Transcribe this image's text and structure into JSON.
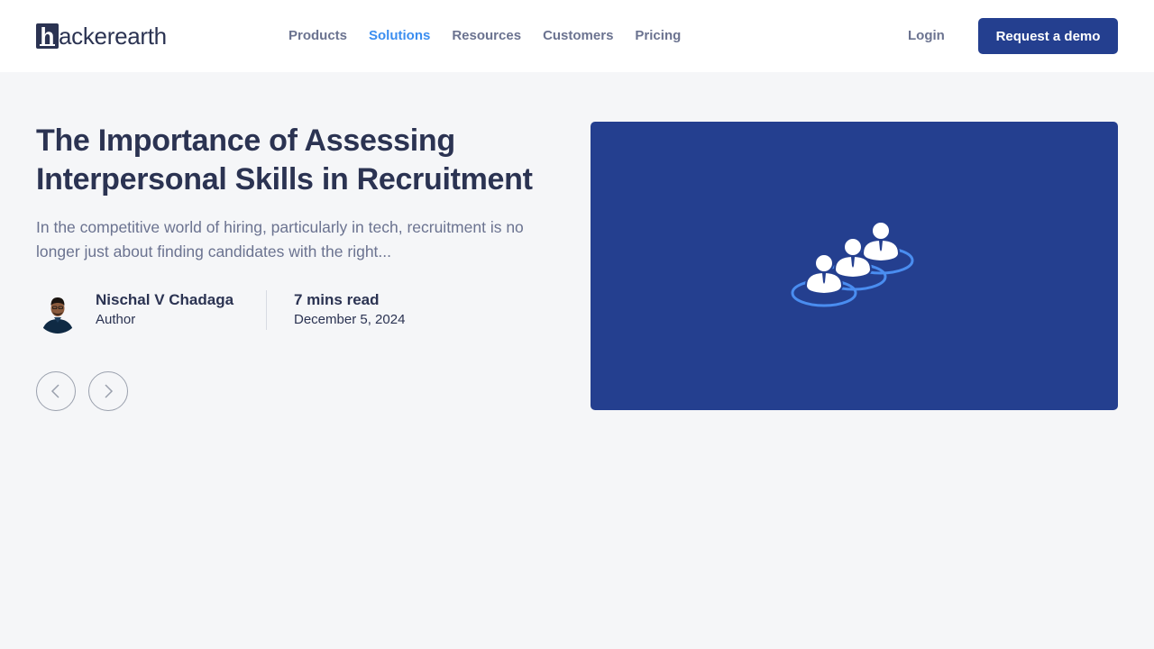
{
  "header": {
    "logo": {
      "mark": "h",
      "text": "ackerearth",
      "full": "hackerearth"
    },
    "nav": [
      {
        "label": "Products",
        "active": false
      },
      {
        "label": "Solutions",
        "active": true
      },
      {
        "label": "Resources",
        "active": false
      },
      {
        "label": "Customers",
        "active": false
      },
      {
        "label": "Pricing",
        "active": false
      }
    ],
    "login_label": "Login",
    "demo_label": "Request a demo"
  },
  "article": {
    "title": "The Importance of Assessing Interpersonal Skills in Recruitment",
    "excerpt": "In the competitive world of hiring, particularly in tech, recruitment is no longer just about finding candidates with the right...",
    "author": {
      "name": "Nischal V Chadaga",
      "role": "Author"
    },
    "read_time": "7 mins read",
    "date": "December 5, 2024"
  },
  "carousel": {
    "prev_icon": "chevron-left-icon",
    "next_icon": "chevron-right-icon"
  },
  "hero": {
    "icon": "team-people-icon",
    "background": "#243f8f",
    "icon_accent": "#4a8df0"
  },
  "colors": {
    "brand": "#243f8f",
    "active_nav": "#3b8ef0",
    "text_dark": "#2b3352",
    "text_muted": "#6b7390",
    "page_bg": "#f5f6f8"
  }
}
